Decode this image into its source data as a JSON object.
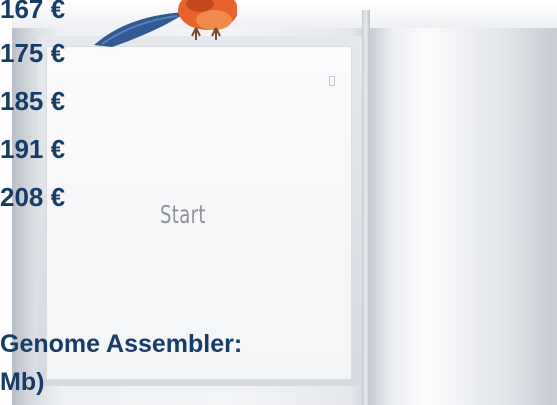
{
  "prices": [
    "167 €",
    "175 €",
    "185 €",
    "191 €",
    "208 €"
  ],
  "device_screen": {
    "button_label": "Start"
  },
  "caption": {
    "line1": "Genome Assembler:",
    "line2": "Mb)"
  },
  "colors": {
    "text_navy": "#173c68",
    "screen_text": "#8e9398",
    "bird_orange": "#e8622c",
    "bird_blue": "#2f5a93"
  },
  "icons": {
    "mascot": "bird-icon"
  }
}
